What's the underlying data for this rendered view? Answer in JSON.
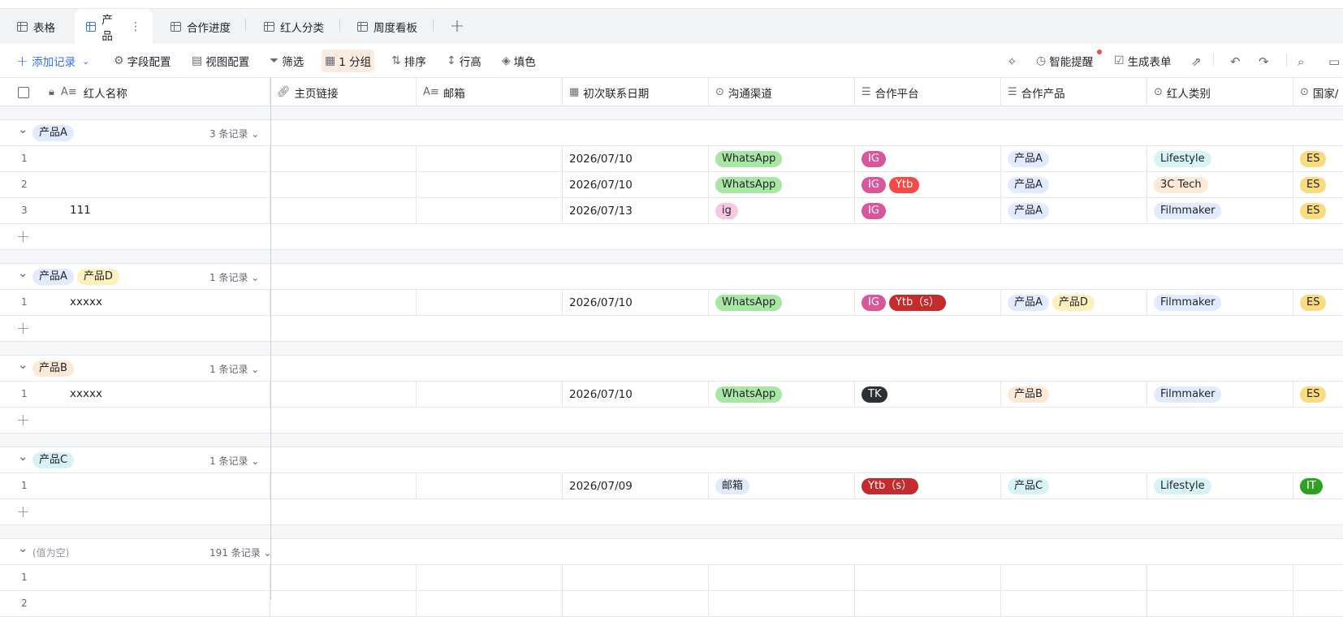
{
  "tabs": [
    {
      "label": "表格"
    },
    {
      "label": "产品",
      "active": true
    },
    {
      "label": "合作进度"
    },
    {
      "label": "红人分类"
    },
    {
      "label": "周度看板"
    }
  ],
  "toolbar": {
    "add_record": "添加记录",
    "field_config": "字段配置",
    "view_config": "视图配置",
    "filter": "筛选",
    "group": "1 分组",
    "sort": "排序",
    "row_height": "行高",
    "fill_color": "填色",
    "smart_reminder": "智能提醒",
    "generate_form": "生成表单"
  },
  "columns": [
    {
      "label": "红人名称"
    },
    {
      "label": "主页链接"
    },
    {
      "label": "邮箱"
    },
    {
      "label": "初次联系日期"
    },
    {
      "label": "沟通渠道"
    },
    {
      "label": "合作平台"
    },
    {
      "label": "合作产品"
    },
    {
      "label": "红人类别"
    },
    {
      "label": "国家/"
    }
  ],
  "groups": [
    {
      "tags": [
        {
          "label": "产品A",
          "color": "#e1eaff"
        }
      ],
      "count": "3 条记录",
      "rows": [
        {
          "num": "1",
          "name": "",
          "date": "2026/07/10",
          "channel": "WhatsApp",
          "platforms": [
            "IG"
          ],
          "products": [
            "产品A"
          ],
          "category": "Lifestyle",
          "country": "ES"
        },
        {
          "num": "2",
          "name": "",
          "date": "2026/07/10",
          "channel": "WhatsApp",
          "platforms": [
            "IG",
            "Ytb"
          ],
          "products": [
            "产品A"
          ],
          "category": "3C Tech",
          "country": "ES"
        },
        {
          "num": "3",
          "name": "111",
          "date": "2026/07/13",
          "channel": "ig",
          "platforms": [
            "IG"
          ],
          "products": [
            "产品A"
          ],
          "category": "Filmmaker",
          "country": "ES"
        }
      ]
    },
    {
      "tags": [
        {
          "label": "产品A",
          "color": "#e1eaff"
        },
        {
          "label": "产品D",
          "color": "#fdf0bc"
        }
      ],
      "count": "1 条记录",
      "rows": [
        {
          "num": "1",
          "name": "xxxxx",
          "date": "2026/07/10",
          "channel": "WhatsApp",
          "platforms": [
            "IG",
            "Ytb（s）"
          ],
          "products": [
            "产品A",
            "产品D"
          ],
          "category": "Filmmaker",
          "country": "ES"
        }
      ]
    },
    {
      "tags": [
        {
          "label": "产品B",
          "color": "#fde9d6"
        }
      ],
      "count": "1 条记录",
      "rows": [
        {
          "num": "1",
          "name": "xxxxx",
          "date": "2026/07/10",
          "channel": "WhatsApp",
          "platforms": [
            "TK"
          ],
          "products": [
            "产品B"
          ],
          "category": "Filmmaker",
          "country": "ES"
        }
      ]
    },
    {
      "tags": [
        {
          "label": "产品C",
          "color": "#d7f3f6"
        }
      ],
      "count": "1 条记录",
      "rows": [
        {
          "num": "1",
          "name": "",
          "date": "2026/07/09",
          "channel": "邮箱",
          "platforms": [
            "Ytb（s）"
          ],
          "products": [
            "产品C"
          ],
          "category": "Lifestyle",
          "country": "IT"
        }
      ]
    }
  ],
  "empty_group": {
    "label": "(值为空)",
    "count": "191 条记录",
    "rows": [
      {
        "num": "1"
      },
      {
        "num": "2"
      }
    ]
  }
}
